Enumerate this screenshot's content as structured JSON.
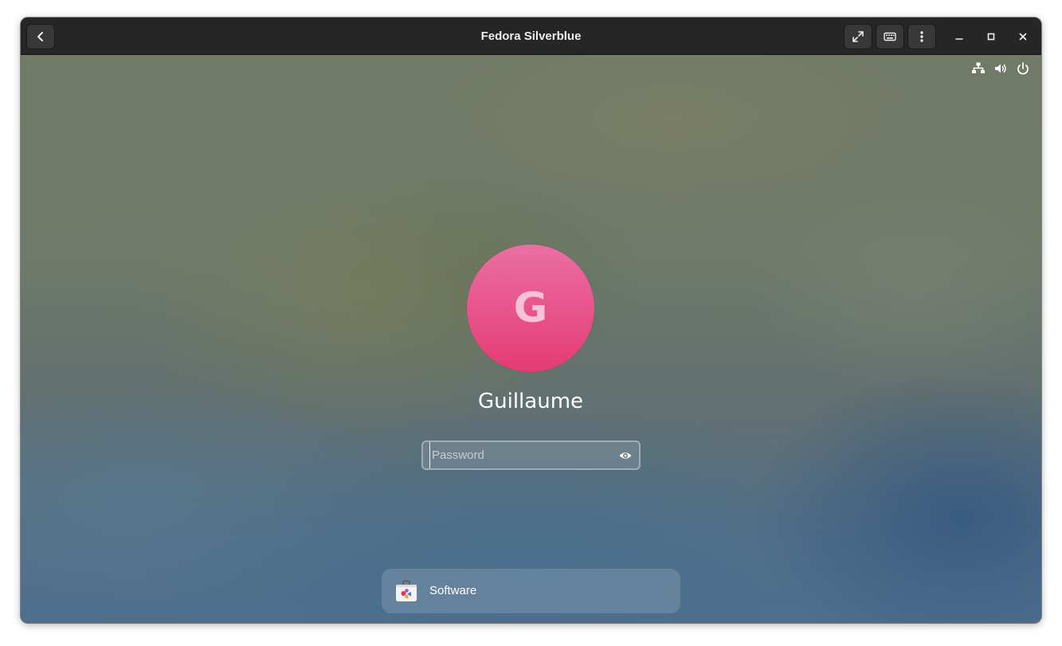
{
  "window": {
    "title": "Fedora Silverblue",
    "back_icon": "chevron-left-icon",
    "buttons": {
      "fullscreen_icon": "fullscreen-icon",
      "keyboard_icon": "keyboard-icon",
      "menu_icon": "vertical-dots-icon",
      "minimize_icon": "minimize-icon",
      "maximize_icon": "maximize-icon",
      "close_icon": "close-icon"
    }
  },
  "system_tray": {
    "network_icon": "wired-network-icon",
    "volume_icon": "volume-icon",
    "power_icon": "power-icon"
  },
  "login": {
    "avatar_initial": "G",
    "avatar_colors": [
      "#ea6fa3",
      "#e53b74"
    ],
    "username": "Guillaume",
    "password_placeholder": "Password",
    "password_value": "",
    "reveal_icon": "eye-icon"
  },
  "notification": {
    "app_icon": "software-bag-icon",
    "label": "Software"
  }
}
